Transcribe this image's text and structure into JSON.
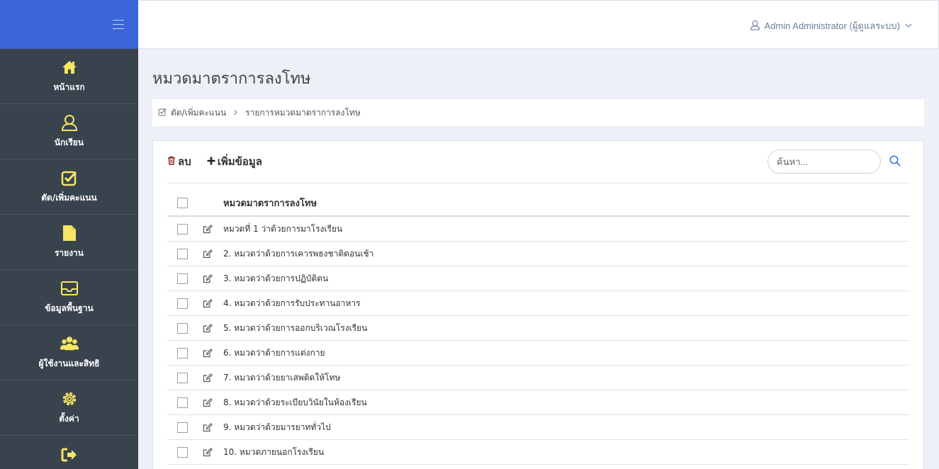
{
  "sidebar": {
    "items": [
      {
        "label": "หน้าแรก",
        "icon": "home-icon"
      },
      {
        "label": "นักเรียน",
        "icon": "student-icon"
      },
      {
        "label": "ตัด/เพิ่มคะแนน",
        "icon": "check-square-icon"
      },
      {
        "label": "รายงาน",
        "icon": "file-icon"
      },
      {
        "label": "ข้อมูลพื้นฐาน",
        "icon": "inbox-icon"
      },
      {
        "label": "ผู้ใช้งานและสิทธิ",
        "icon": "users-icon"
      },
      {
        "label": "ตั้งค่า",
        "icon": "gear-icon"
      },
      {
        "label": "",
        "icon": "logout-icon"
      }
    ]
  },
  "header": {
    "user": "Admin Administrator (ผู้ดูแลระบบ)"
  },
  "page": {
    "title": "หมวดมาตราการลงโทษ"
  },
  "breadcrumb": {
    "items": [
      "ตัด/เพิ่มคะแนน",
      "รายการหมวดมาตราการลงโทษ"
    ]
  },
  "toolbar": {
    "delete_label": "ลบ",
    "add_label": "เพิ่มข้อมูล",
    "search_placeholder": "ค้นหา..."
  },
  "table": {
    "header": "หมวดมาตราการลงโทษ",
    "rows": [
      "หมวดที่ 1 ว่าด้วยการมาโรงเรียน",
      "2. หมวดว่าด้วยการเคารพธงชาติตอนเช้า",
      "3. หมวดว่าด้วยการปฏิบัติตน",
      "4. หมวดว่าด้วยการรับประทานอาหาร",
      "5. หมวดว่าด้วยการออกบริเวณโรงเรียน",
      "6. หมวดว่าด้ายการแต่งกาย",
      "7. หมวดว่าด้วยยาเสพติดให้โทษ",
      "8. หมวดว่าด้วยระเบียบวินัยในห้องเรียน",
      "9. หมวดว่าด้วยมารยาททั่วไป",
      "10. หมวดภายนอกโรงเรียน"
    ]
  },
  "colors": {
    "sidebar": "#39434e",
    "brand": "#3a64d8",
    "icon_yellow": "#f5e663",
    "link_blue": "#3a7bd5"
  }
}
